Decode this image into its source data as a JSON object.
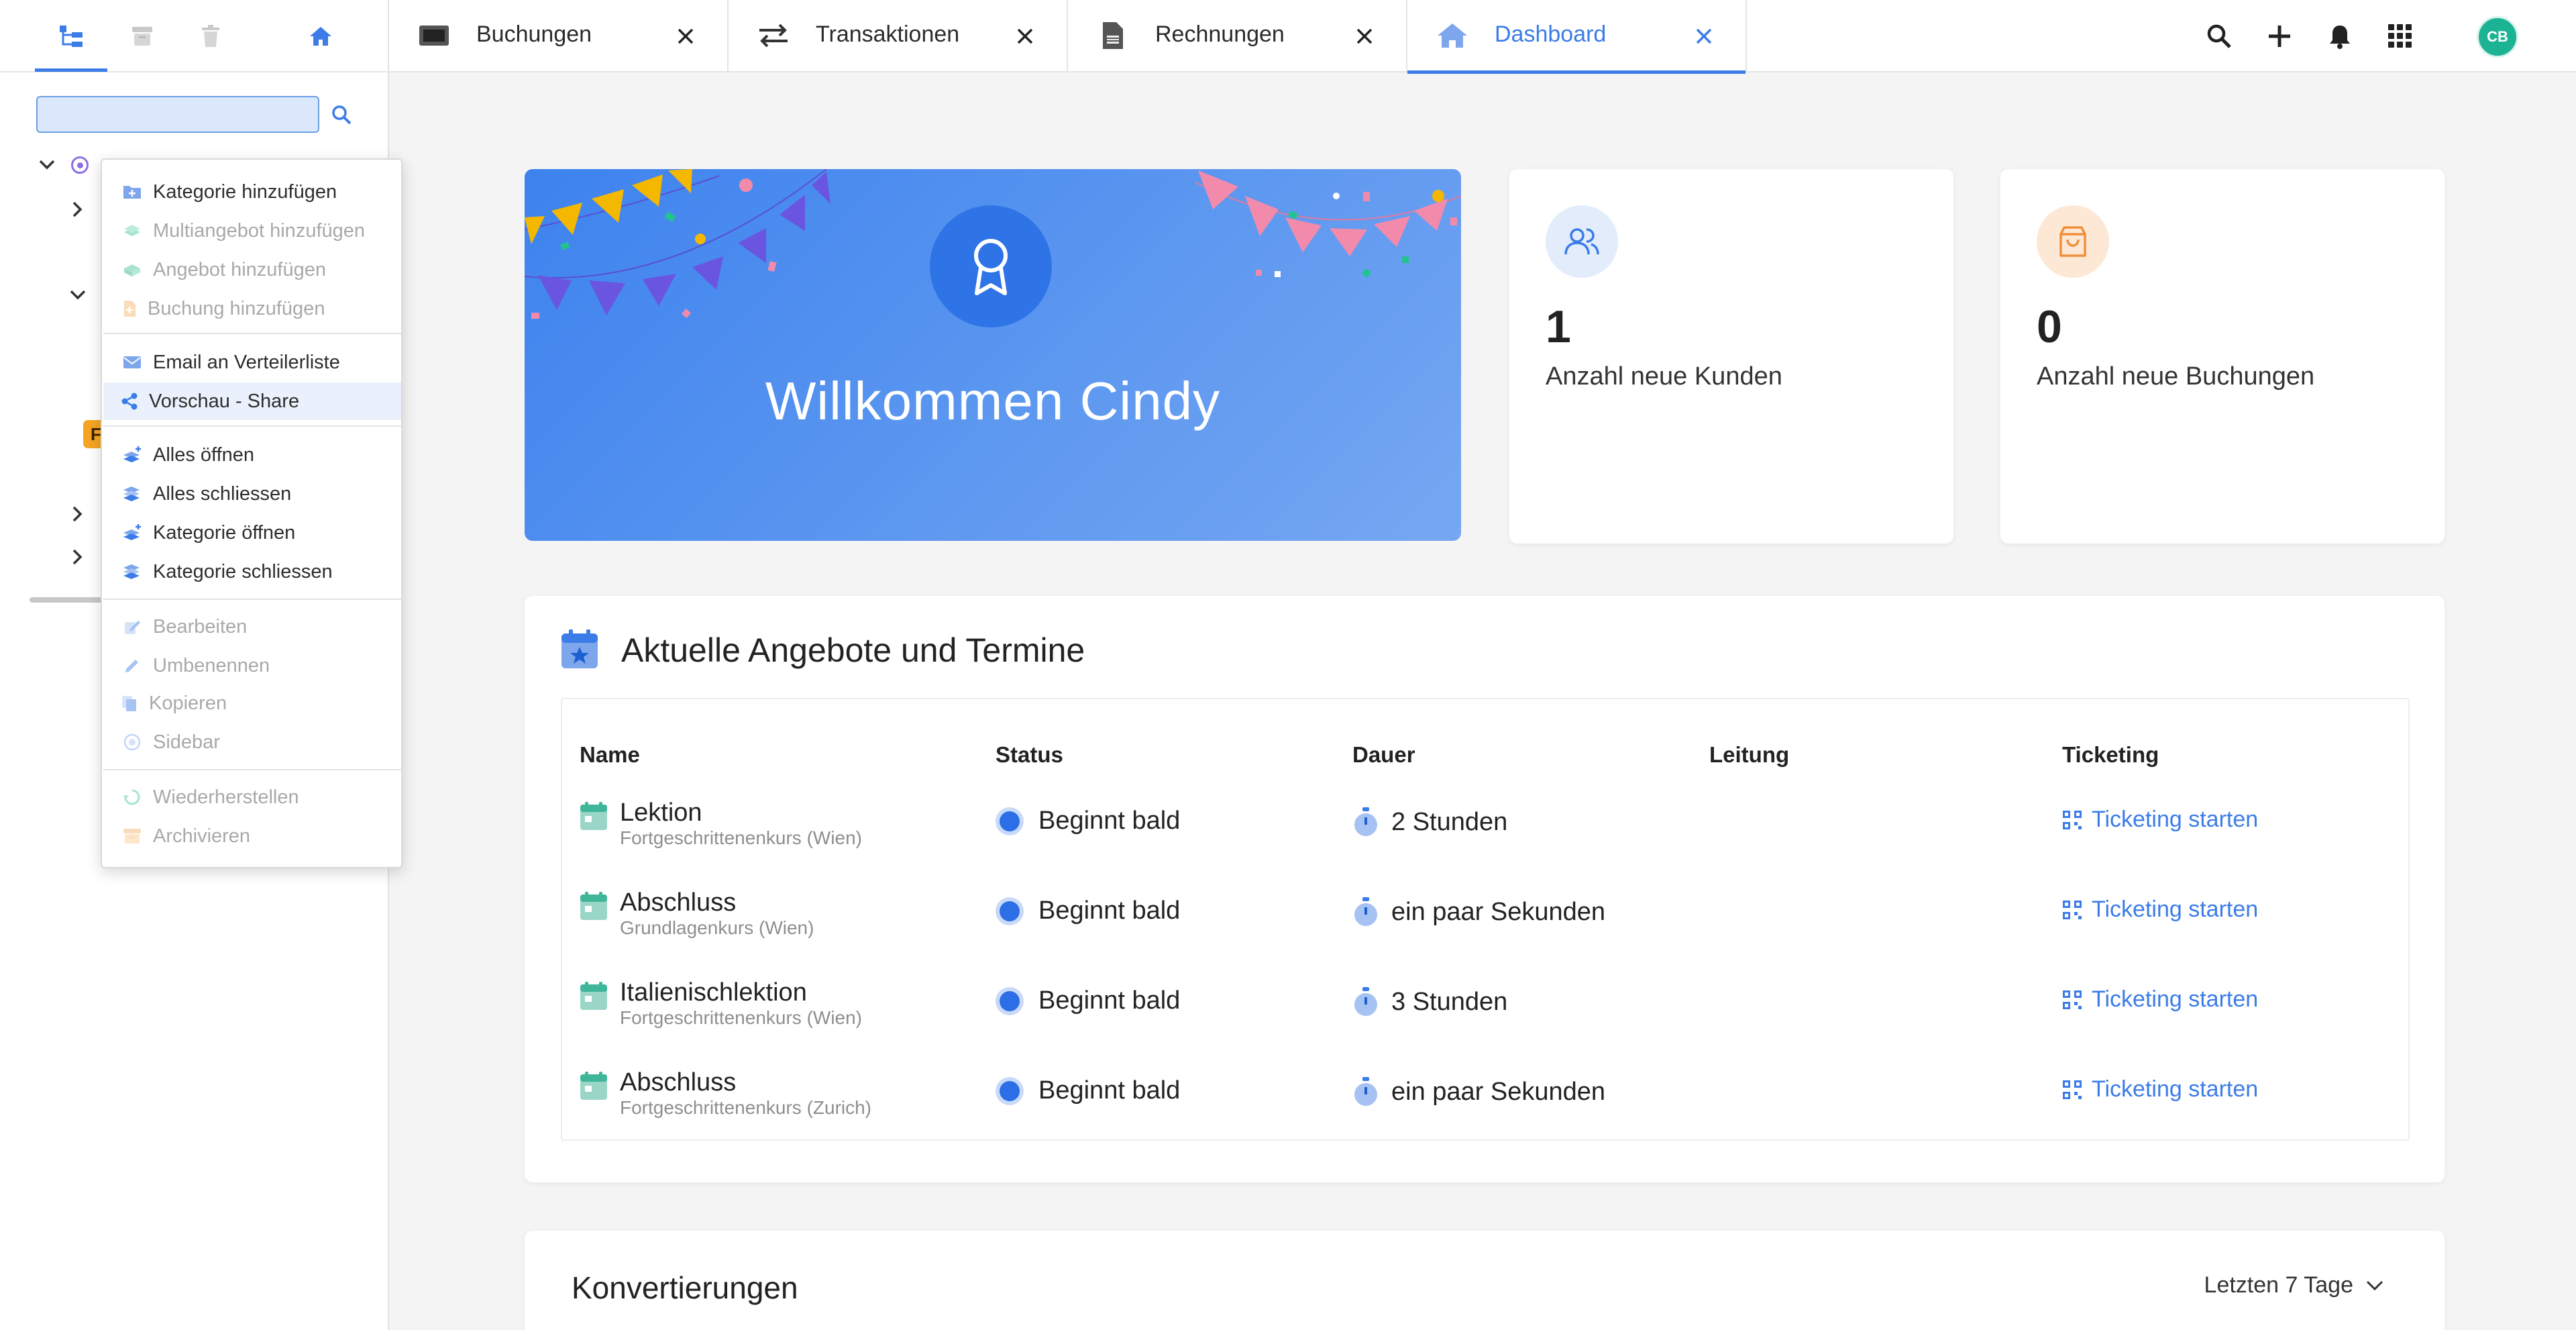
{
  "sidebar": {
    "icons": [
      "tree-view-icon",
      "archive-icon",
      "trash-icon",
      "home-icon"
    ],
    "search": {
      "value": "",
      "placeholder": ""
    },
    "badge": "F"
  },
  "context_menu": {
    "items": [
      {
        "label": "Kategorie hinzufügen",
        "icon": "add-category-icon",
        "enabled": true
      },
      {
        "label": "Multiangebot hinzufügen",
        "icon": "multi-offer-icon",
        "enabled": false
      },
      {
        "label": "Angebot hinzufügen",
        "icon": "offer-icon",
        "enabled": false
      },
      {
        "label": "Buchung hinzufügen",
        "icon": "booking-icon",
        "enabled": false
      },
      {
        "label": "Email an Verteilerliste",
        "icon": "mail-icon",
        "enabled": true
      },
      {
        "label": "Vorschau - Share",
        "icon": "share-icon",
        "enabled": true
      },
      {
        "label": "Alles öffnen",
        "icon": "expand-all-icon",
        "enabled": true
      },
      {
        "label": "Alles schliessen",
        "icon": "collapse-all-icon",
        "enabled": true
      },
      {
        "label": "Kategorie öffnen",
        "icon": "open-category-icon",
        "enabled": true
      },
      {
        "label": "Kategorie schliessen",
        "icon": "close-category-icon",
        "enabled": true
      },
      {
        "label": "Bearbeiten",
        "icon": "edit-icon",
        "enabled": false
      },
      {
        "label": "Umbenennen",
        "icon": "rename-icon",
        "enabled": false
      },
      {
        "label": "Kopieren",
        "icon": "copy-icon",
        "enabled": false
      },
      {
        "label": "Sidebar",
        "icon": "sidebar-icon",
        "enabled": false
      },
      {
        "label": "Wiederherstellen",
        "icon": "restore-icon",
        "enabled": false
      },
      {
        "label": "Archivieren",
        "icon": "archive-icon",
        "enabled": false
      }
    ]
  },
  "tabs": [
    {
      "label": "Buchungen",
      "icon": "ticket-icon",
      "active": false
    },
    {
      "label": "Transaktionen",
      "icon": "transfer-icon",
      "active": false
    },
    {
      "label": "Rechnungen",
      "icon": "invoice-icon",
      "active": false
    },
    {
      "label": "Dashboard",
      "icon": "home-icon",
      "active": true
    }
  ],
  "top_actions": [
    "search-icon",
    "plus-icon",
    "bell-icon",
    "apps-grid-icon"
  ],
  "user": {
    "initials": "CB"
  },
  "hero": {
    "title": "Willkommen Cindy"
  },
  "stats": [
    {
      "value": "1",
      "label": "Anzahl neue Kunden",
      "icon": "users-icon"
    },
    {
      "value": "0",
      "label": "Anzahl neue Buchungen",
      "icon": "shopping-bag-icon"
    }
  ],
  "offers": {
    "title": "Aktuelle Angebote und Termine",
    "columns": [
      "Name",
      "Status",
      "Dauer",
      "Leitung",
      "Ticketing"
    ],
    "rows": [
      {
        "name": "Lektion",
        "course": "Fortgeschrittenenkurs (Wien)",
        "status": "Beginnt bald",
        "duration": "2 Stunden",
        "lead": "",
        "ticketing": "Ticketing starten"
      },
      {
        "name": "Abschluss",
        "course": "Grundlagenkurs (Wien)",
        "status": "Beginnt bald",
        "duration": "ein paar Sekunden",
        "lead": "",
        "ticketing": "Ticketing starten"
      },
      {
        "name": "Italienischlektion",
        "course": "Fortgeschrittenenkurs (Wien)",
        "status": "Beginnt bald",
        "duration": "3 Stunden",
        "lead": "",
        "ticketing": "Ticketing starten"
      },
      {
        "name": "Abschluss",
        "course": "Fortgeschrittenenkurs (Zurich)",
        "status": "Beginnt bald",
        "duration": "ein paar Sekunden",
        "lead": "",
        "ticketing": "Ticketing starten"
      }
    ]
  },
  "conversions": {
    "title": "Konvertierungen",
    "range": "Letzten 7 Tage"
  },
  "colors": {
    "accent": "#3b7ce8",
    "badge": "#f5a523",
    "avatar": "#1bb394",
    "hero_from": "#3d82ee",
    "hero_to": "#76a7f2"
  }
}
